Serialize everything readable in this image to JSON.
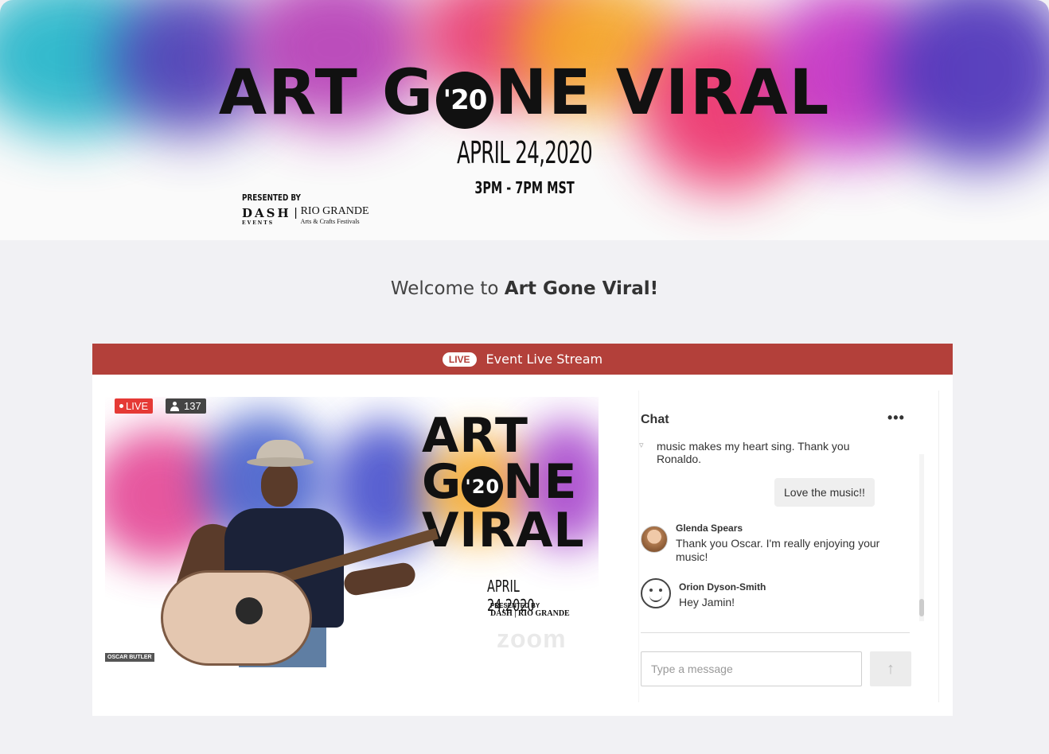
{
  "banner": {
    "title_part1": "ART G",
    "title_badge": "'20",
    "title_part2": "NE VIRAL",
    "date": "APRIL 24,2020",
    "time": "3PM - 7PM MST",
    "presented_by": "PRESENTED BY",
    "org1": "DASH",
    "org1_sub": "EVENTS",
    "org2": "RIO GRANDE",
    "org2_sub": "Arts & Crafts Festivals"
  },
  "welcome": {
    "prefix": "Welcome to ",
    "event_name": "Art Gone Viral!"
  },
  "stream": {
    "live_pill": "LIVE",
    "title": "Event Live Stream"
  },
  "video": {
    "live_label": "LIVE",
    "viewer_count": "137",
    "art_line1": "ART",
    "art_line2a": "G",
    "art_badge": "'20",
    "art_line2b": "NE",
    "art_line3": "VIRAL",
    "date": "APRIL 24,2020",
    "presented_by": "PRESENTED BY",
    "orgs": "DASH | RIO GRANDE",
    "zoom": "zoom",
    "speaker_name": "OSCAR BUTLER"
  },
  "chat": {
    "title": "Chat",
    "more": "•••",
    "messages": [
      {
        "text": "music makes my heart sing. Thank you Ronaldo."
      },
      {
        "text": "Love the music!!"
      },
      {
        "sender": "Glenda Spears",
        "text": "Thank you Oscar. I'm really enjoying your music!"
      },
      {
        "sender": "Orion Dyson-Smith",
        "text": "Hey Jamin!"
      }
    ],
    "input_placeholder": "Type a message",
    "send_icon": "up-arrow-icon"
  },
  "colors": {
    "accent": "#b3403a",
    "live_red": "#e53935",
    "page_bg": "#f1f1f4"
  }
}
